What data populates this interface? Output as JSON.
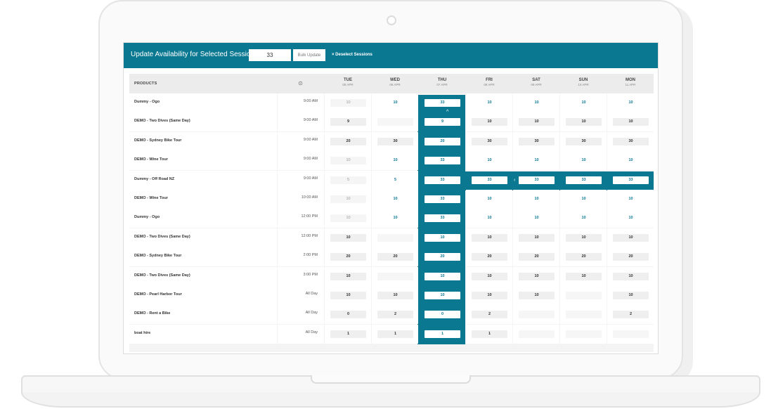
{
  "topbar": {
    "title": "Update Availability for Selected Sessions",
    "input_value": "33",
    "bulk_update_label": "Bulk Update",
    "deselect_label": "× Deselect Sessions"
  },
  "header": {
    "products_label": "PRODUCTS",
    "clock_icon": "clock-icon",
    "days": [
      {
        "dow": "TUE",
        "date": "05 APR"
      },
      {
        "dow": "WED",
        "date": "06 APR"
      },
      {
        "dow": "THU",
        "date": "07 APR"
      },
      {
        "dow": "FRI",
        "date": "08 APR"
      },
      {
        "dow": "SAT",
        "date": "09 APR"
      },
      {
        "dow": "SUN",
        "date": "10 APR"
      },
      {
        "dow": "MON",
        "date": "11 APR"
      }
    ]
  },
  "rows": [
    {
      "product": "Dummy - Ogo",
      "time": "9:00 AM",
      "values": [
        "10",
        "10",
        "33",
        "10",
        "10",
        "10",
        "10"
      ]
    },
    {
      "product": "DEMO - Two Dives (Same Day)",
      "time": "9:00 AM",
      "values": [
        "9",
        "",
        "9",
        "10",
        "10",
        "10",
        "10"
      ]
    },
    {
      "product": "DEMO - Sydney Bike Tour",
      "time": "9:00 AM",
      "values": [
        "20",
        "30",
        "20",
        "30",
        "30",
        "30",
        "30"
      ]
    },
    {
      "product": "DEMO - Wine Tour",
      "time": "9:00 AM",
      "values": [
        "10",
        "10",
        "33",
        "10",
        "10",
        "10",
        "10"
      ]
    },
    {
      "product": "Dummy - Off Road NZ",
      "time": "9:00 AM",
      "values": [
        "5",
        "5",
        "33",
        "33",
        "33",
        "33",
        "33"
      ]
    },
    {
      "product": "DEMO - Wine Tour",
      "time": "10:00 AM",
      "values": [
        "10",
        "10",
        "33",
        "10",
        "10",
        "10",
        "10"
      ]
    },
    {
      "product": "Dummy - Ogo",
      "time": "12:00 PM",
      "values": [
        "10",
        "10",
        "33",
        "10",
        "10",
        "10",
        "10"
      ]
    },
    {
      "product": "DEMO - Two Dives (Same Day)",
      "time": "12:00 PM",
      "values": [
        "10",
        "",
        "10",
        "10",
        "10",
        "10",
        "10"
      ]
    },
    {
      "product": "DEMO - Sydney Bike Tour",
      "time": "2:00 PM",
      "values": [
        "20",
        "20",
        "20",
        "20",
        "20",
        "20",
        "20"
      ]
    },
    {
      "product": "DEMO - Two Dives (Same Day)",
      "time": "3:00 PM",
      "values": [
        "10",
        "",
        "10",
        "10",
        "10",
        "10",
        "10"
      ]
    },
    {
      "product": "DEMO - Pearl Harbor Tour",
      "time": "All Day",
      "values": [
        "10",
        "10",
        "10",
        "10",
        "10",
        "",
        "10"
      ]
    },
    {
      "product": "DEMO - Rent a Bike",
      "time": "All Day",
      "values": [
        "0",
        "2",
        "0",
        "2",
        "",
        "",
        "2"
      ]
    },
    {
      "product": "boat hire",
      "time": "All Day",
      "values": [
        "1",
        "1",
        "1",
        "1",
        "",
        "",
        ""
      ]
    }
  ],
  "styles": [
    [
      "faded",
      "link",
      "sel",
      "link",
      "link",
      "link",
      "link"
    ],
    [
      "grey",
      "empty",
      "sel",
      "grey",
      "grey",
      "grey",
      "grey"
    ],
    [
      "grey",
      "grey",
      "sel",
      "grey",
      "grey",
      "grey",
      "grey"
    ],
    [
      "faded",
      "link",
      "sel",
      "link",
      "link",
      "link",
      "link"
    ],
    [
      "faded",
      "link",
      "sel",
      "sel",
      "sel",
      "sel",
      "sel"
    ],
    [
      "faded",
      "link",
      "sel",
      "link",
      "link",
      "link",
      "link"
    ],
    [
      "faded",
      "link",
      "sel",
      "link",
      "link",
      "link",
      "link"
    ],
    [
      "grey",
      "empty",
      "sel",
      "grey",
      "grey",
      "grey",
      "grey"
    ],
    [
      "grey",
      "grey",
      "sel",
      "grey",
      "grey",
      "grey",
      "grey"
    ],
    [
      "grey",
      "empty",
      "sel",
      "grey",
      "grey",
      "grey",
      "grey"
    ],
    [
      "grey",
      "grey",
      "sel",
      "grey",
      "grey",
      "empty",
      "grey"
    ],
    [
      "grey",
      "grey",
      "sel",
      "grey",
      "empty",
      "empty",
      "grey"
    ],
    [
      "grey",
      "grey",
      "sel",
      "grey",
      "empty",
      "empty",
      "empty"
    ]
  ],
  "colors": {
    "accent": "#0b7891",
    "panel": "#f4f4f4"
  }
}
